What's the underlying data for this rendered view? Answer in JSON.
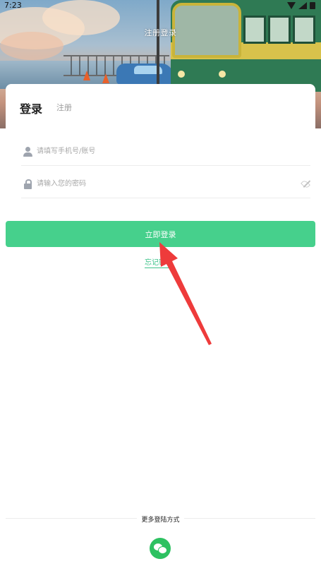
{
  "status_bar": {
    "time": "7:23"
  },
  "header": {
    "title": "注册登录"
  },
  "tabs": {
    "login": "登录",
    "register": "注册"
  },
  "form": {
    "username_placeholder": "请填写手机号/账号",
    "password_placeholder": "请输入您的密码"
  },
  "actions": {
    "login_button": "立即登录",
    "forgot_password": "忘记密码"
  },
  "footer": {
    "more_methods": "更多登陆方式"
  },
  "colors": {
    "primary": "#46d08c",
    "wechat": "#2dc161",
    "annotation_arrow": "#ee3b3b"
  },
  "icons": [
    "user-icon",
    "lock-icon",
    "eye-off-icon",
    "wechat-icon",
    "red-arrow-annotation"
  ]
}
